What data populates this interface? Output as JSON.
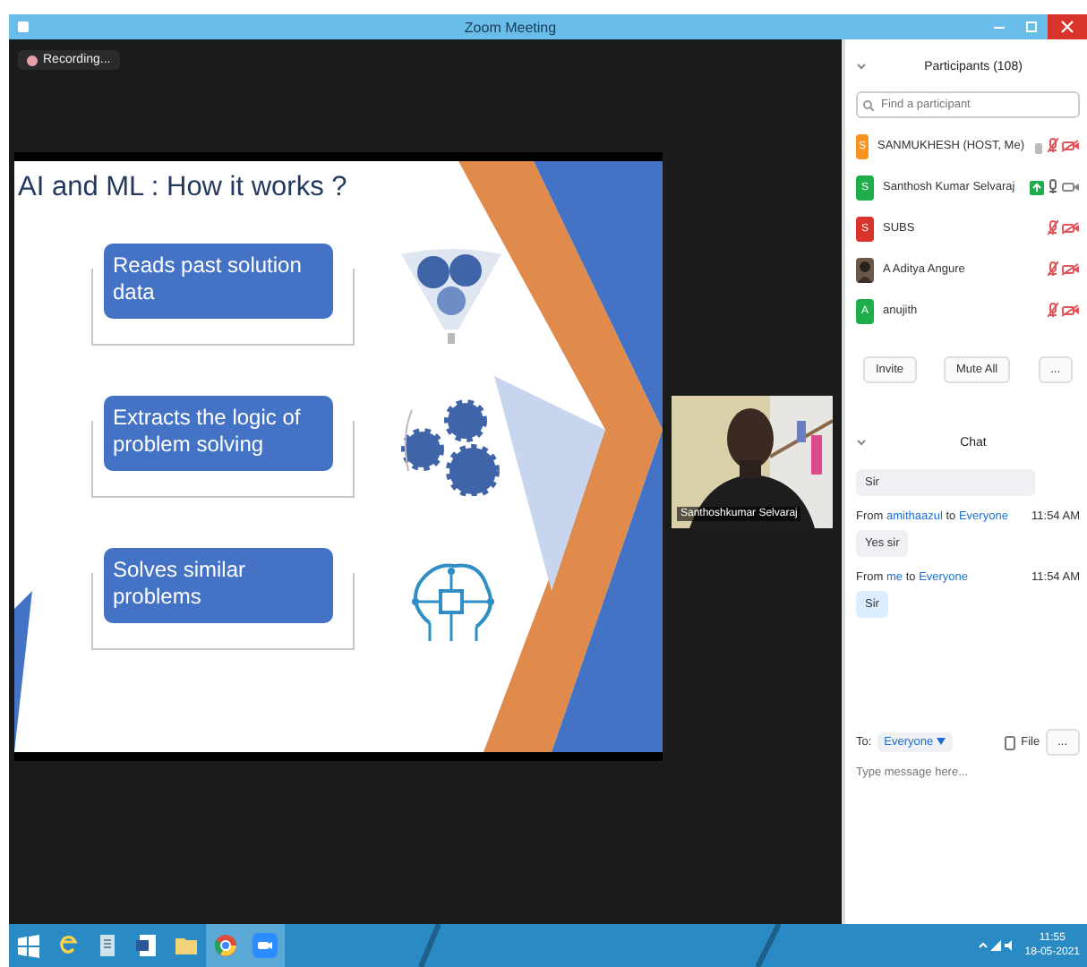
{
  "window": {
    "title": "Zoom Meeting"
  },
  "recording": {
    "label": "Recording..."
  },
  "slide": {
    "title": "AI and ML : How it works ?",
    "steps": [
      {
        "text": "Reads past solution data",
        "kind": "funnel"
      },
      {
        "text": "Extracts the logic of problem solving",
        "kind": "gears"
      },
      {
        "text": "Solves similar problems",
        "kind": "circuit"
      }
    ]
  },
  "video": {
    "name": "Santhoshkumar Selvaraj"
  },
  "participants": {
    "title": "Participants (108)",
    "search": {
      "placeholder": "Find a participant"
    },
    "items": [
      {
        "name": "SANMUKHESH (HOST, Me)",
        "avatar": "S",
        "color": "#f7931e",
        "kind": "letter",
        "sharing": false,
        "hand": true,
        "mic_muted": true,
        "video_off": true
      },
      {
        "name": "Santhosh Kumar Selvaraj",
        "avatar": "S",
        "color": "#1fae4b",
        "kind": "letter",
        "sharing": true,
        "hand": false,
        "mic_muted": false,
        "video_off": false
      },
      {
        "name": "SUBS",
        "avatar": "S",
        "color": "#d9342b",
        "kind": "letter",
        "sharing": false,
        "hand": false,
        "mic_muted": true,
        "video_off": true
      },
      {
        "name": "A Aditya Angure",
        "sharing": false,
        "hand": false,
        "mic_muted": true,
        "video_off": true
      },
      {
        "name": "anujith",
        "avatar": "A",
        "color": "#1fae4b",
        "kind": "letter",
        "sharing": false,
        "hand": false,
        "mic_muted": true,
        "video_off": true
      }
    ],
    "buttons": [
      "Invite",
      "Mute All",
      "..."
    ]
  },
  "chat": {
    "title": "Chat",
    "messages": [
      {
        "kind": "received",
        "text": "Sir"
      },
      {
        "kind": "received",
        "from": "amithaazul",
        "to": "Everyone",
        "prefix": "From",
        "mid": "to",
        "time": "11:54 AM",
        "text": "Yes sir"
      },
      {
        "kind": "sent",
        "from": "me",
        "to": "Everyone",
        "prefix": "From",
        "mid": "to",
        "time": "11:54 AM",
        "text": "Sir"
      }
    ],
    "to_label": "To:",
    "recipient": "Everyone",
    "file": "File",
    "more": "...",
    "placeholder": "Type message here..."
  },
  "taskbar": {
    "time": "11:55",
    "date": "18-05-2021"
  }
}
